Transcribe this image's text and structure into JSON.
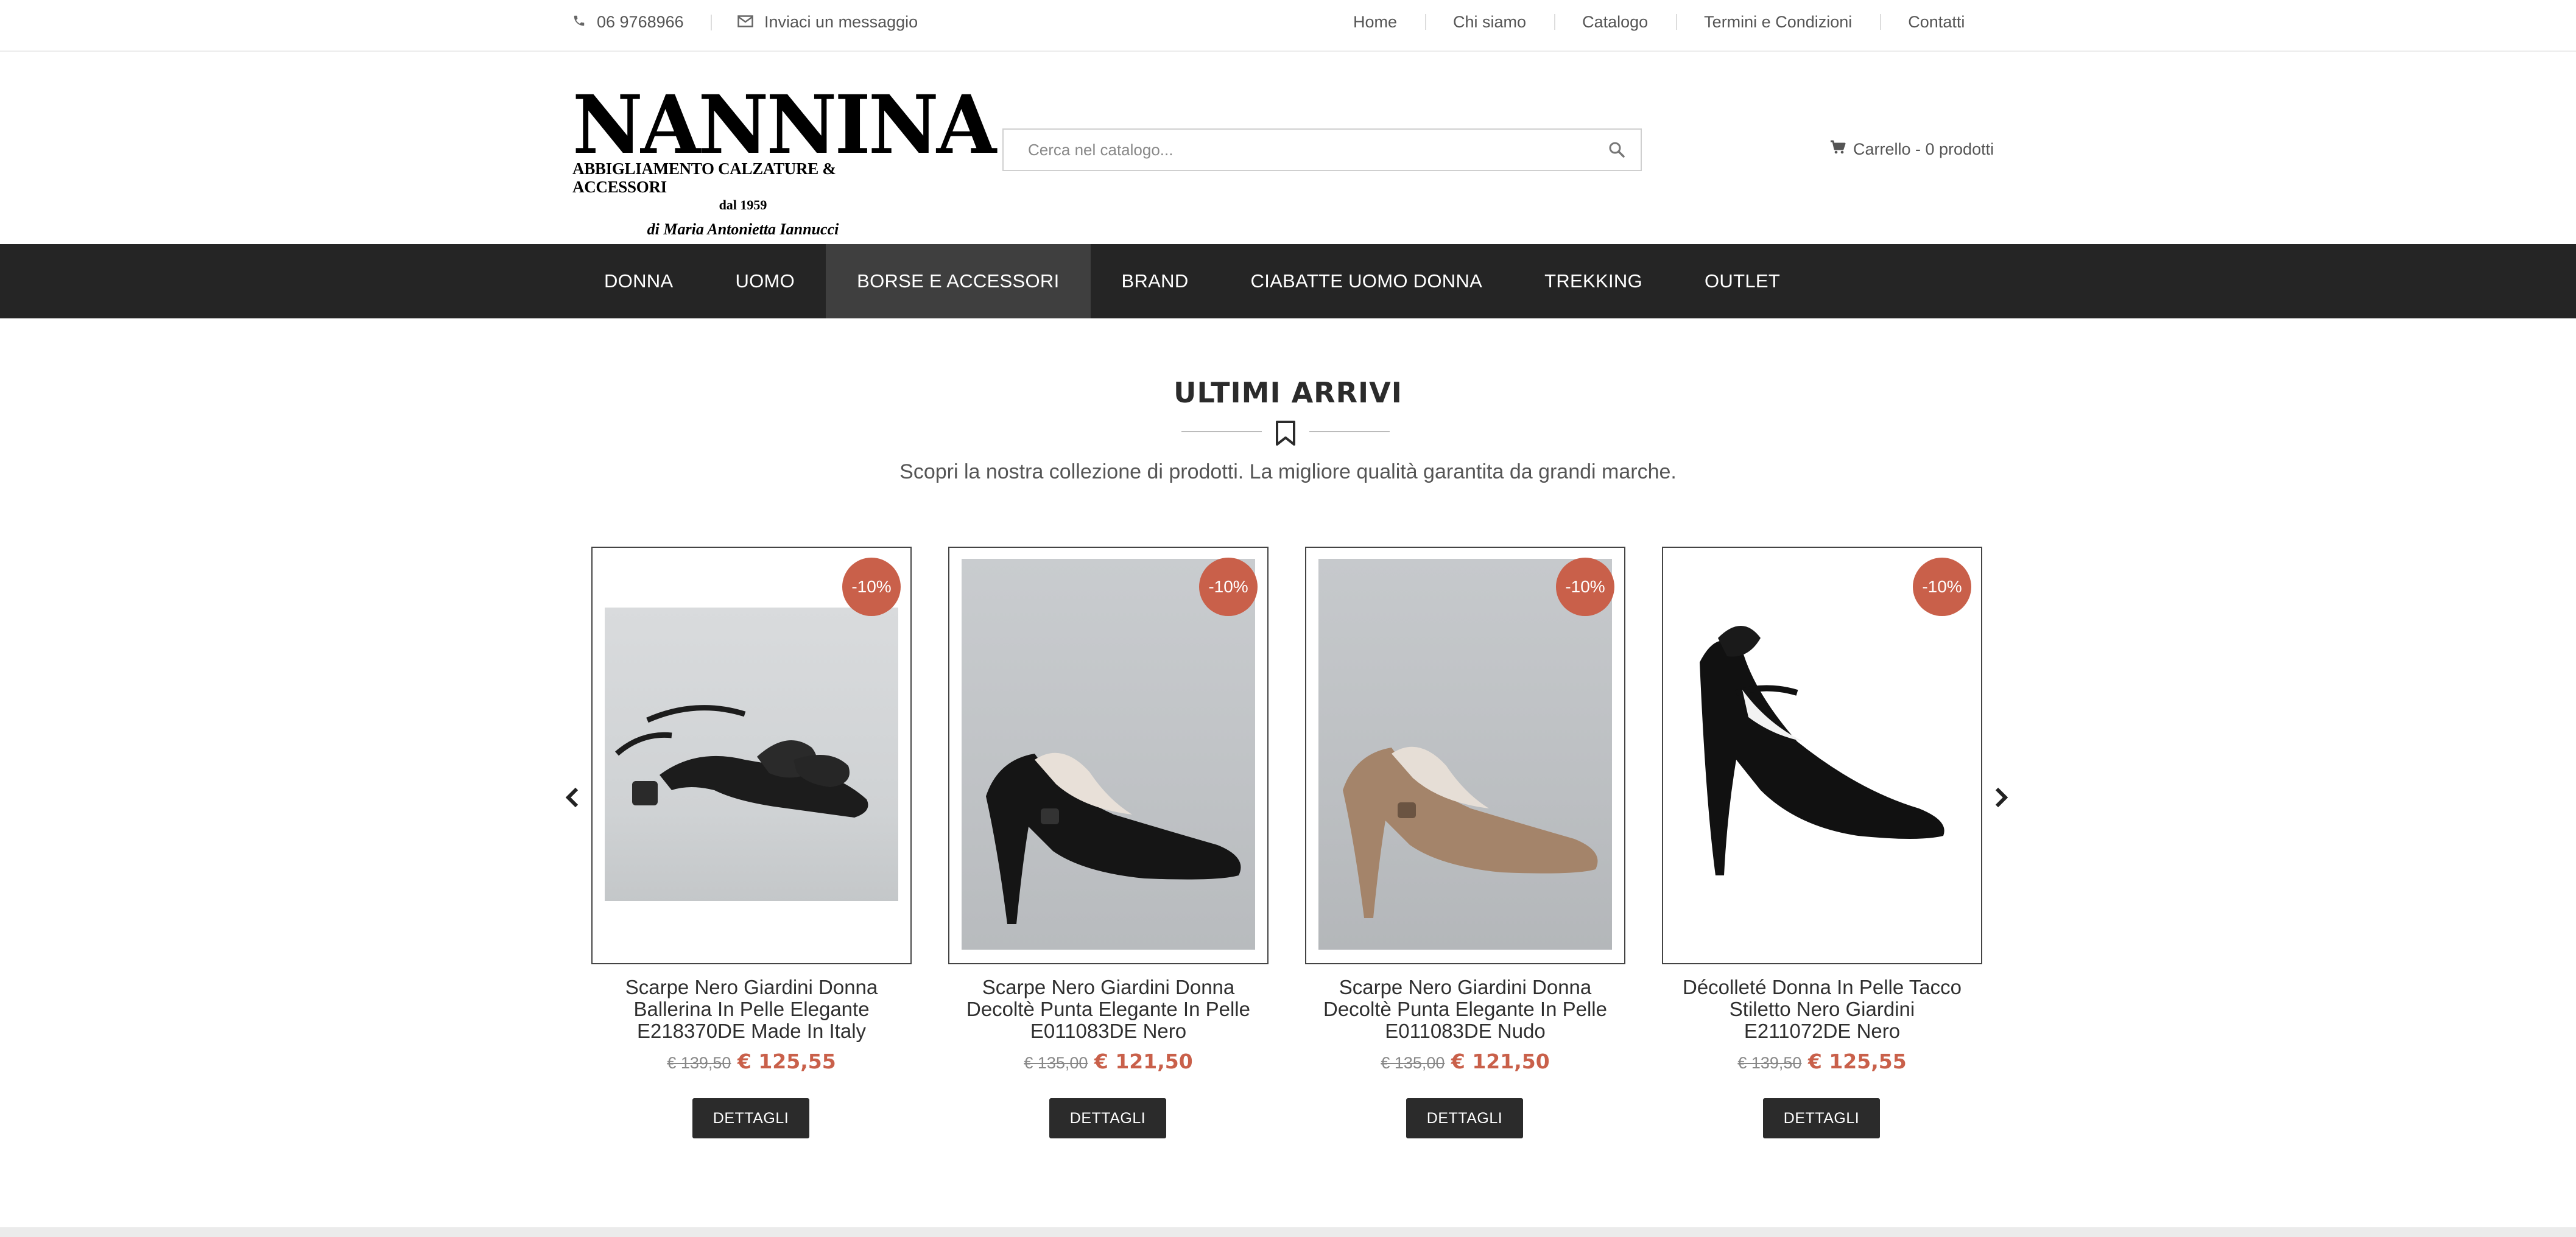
{
  "topbar": {
    "phone": "06 9768966",
    "message": "Inviaci un messaggio",
    "links": [
      "Home",
      "Chi siamo",
      "Catalogo",
      "Termini e Condizioni",
      "Contatti"
    ]
  },
  "logo": {
    "brand": "NANNINA",
    "tagline": "ABBIGLIAMENTO CALZATURE & ACCESSORI",
    "since": "dal 1959",
    "signature": "di Maria Antonietta Iannucci"
  },
  "search": {
    "placeholder": "Cerca nel catalogo..."
  },
  "cart": {
    "label": "Carrello - 0 prodotti"
  },
  "mainnav": {
    "items": [
      "DONNA",
      "UOMO",
      "BORSE E ACCESSORI",
      "BRAND",
      "CIABATTE UOMO DONNA",
      "TREKKING",
      "OUTLET"
    ],
    "active": "BORSE E ACCESSORI"
  },
  "section": {
    "title": "ULTIMI ARRIVI",
    "subtitle": "Scopri la nostra collezione di prodotti. La migliore qualità garantita da grandi marche."
  },
  "products": [
    {
      "badge": "-10%",
      "name": "Scarpe Nero Giardini Donna Ballerina In Pelle Elegante E218370DE Made In Italy",
      "old_price": "€ 139,50",
      "price": "€ 125,55",
      "button": "DETTAGLI",
      "image": "black flat slingback with bow"
    },
    {
      "badge": "-10%",
      "name": "Scarpe Nero Giardini Donna Decoltè Punta Elegante In Pelle E011083DE Nero",
      "old_price": "€ 135,00",
      "price": "€ 121,50",
      "button": "DETTAGLI",
      "image": "black pointed heel pump"
    },
    {
      "badge": "-10%",
      "name": "Scarpe Nero Giardini Donna Decoltè Punta Elegante In Pelle E011083DE Nudo",
      "old_price": "€ 135,00",
      "price": "€ 121,50",
      "button": "DETTAGLI",
      "image": "nude patent heel pump"
    },
    {
      "badge": "-10%",
      "name": "Décolleté Donna In Pelle Tacco Stiletto Nero Giardini E211072DE Nero",
      "old_price": "€ 139,50",
      "price": "€ 125,55",
      "button": "DETTAGLI",
      "image": "black stiletto with ankle strap"
    }
  ],
  "colors": {
    "nav_bg": "#252525",
    "nav_active": "#3f3f3f",
    "accent": "#c9604a",
    "button": "#2b2b2b"
  },
  "icons": [
    "phone-icon",
    "envelope-icon",
    "search-icon",
    "cart-icon",
    "bookmark-icon",
    "carousel-prev-icon",
    "carousel-next-icon"
  ]
}
